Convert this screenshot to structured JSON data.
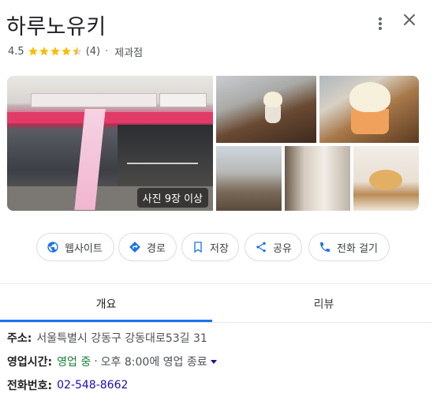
{
  "place": {
    "name": "하루노유키",
    "rating": "4.5",
    "rating_value": 4.5,
    "review_count": "(4)",
    "separator": "·",
    "category": "제과점"
  },
  "photos": {
    "count_label": "사진 9장 이상"
  },
  "actions": {
    "website": "웹사이트",
    "route": "경로",
    "save": "저장",
    "share": "공유",
    "call": "전화 걸기"
  },
  "tabs": {
    "overview": "개요",
    "reviews": "리뷰"
  },
  "info": {
    "address_label": "주소:",
    "address_value": "서울특별시 강동구 강동대로53길 31",
    "hours_label": "영업시간:",
    "hours_status": "영업 중",
    "hours_separator": "·",
    "hours_detail": "오후 8:00에 영업 종료",
    "phone_label": "전화번호:",
    "phone_value": "02-548-8662"
  },
  "colors": {
    "star": "#fbbc04",
    "link": "#1a0dab",
    "open": "#188038",
    "accent": "#1a73e8"
  }
}
